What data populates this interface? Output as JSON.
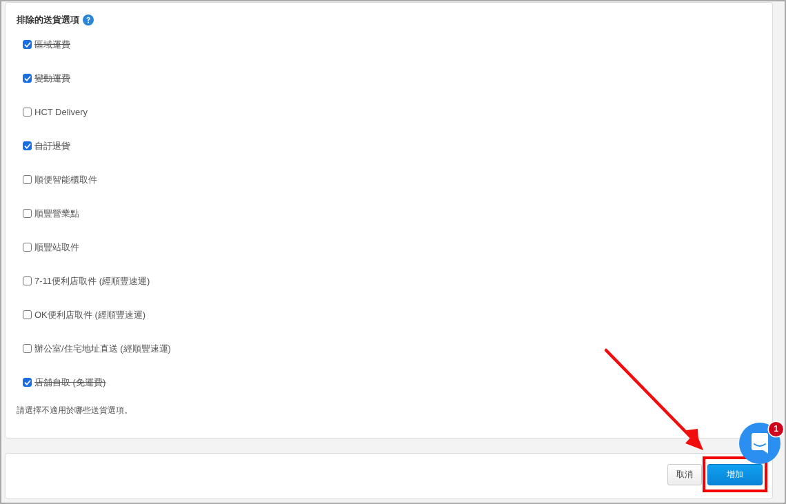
{
  "section": {
    "title": "排除的送貨選項"
  },
  "options": [
    {
      "label": "區域運費",
      "checked": true
    },
    {
      "label": "變動運費",
      "checked": true
    },
    {
      "label": "HCT Delivery",
      "checked": false
    },
    {
      "label": "自訂退貨",
      "checked": true
    },
    {
      "label": "順便智能櫃取件",
      "checked": false
    },
    {
      "label": "順豐營業點",
      "checked": false
    },
    {
      "label": "順豐站取件",
      "checked": false
    },
    {
      "label": "7-11便利店取件 (經順豐速運)",
      "checked": false
    },
    {
      "label": "OK便利店取件 (經順豐速運)",
      "checked": false
    },
    {
      "label": "辦公室/住宅地址直送 (經順豐速運)",
      "checked": false
    },
    {
      "label": "店舖自取 (免運費)",
      "checked": true
    }
  ],
  "hint": "請選擇不適用於哪些送貨選項。",
  "footer": {
    "buttons": [
      {
        "label": "取消",
        "kind": "secondary"
      },
      {
        "label": "增加",
        "kind": "primary"
      }
    ]
  },
  "chat_widget": {
    "badge": "1"
  }
}
